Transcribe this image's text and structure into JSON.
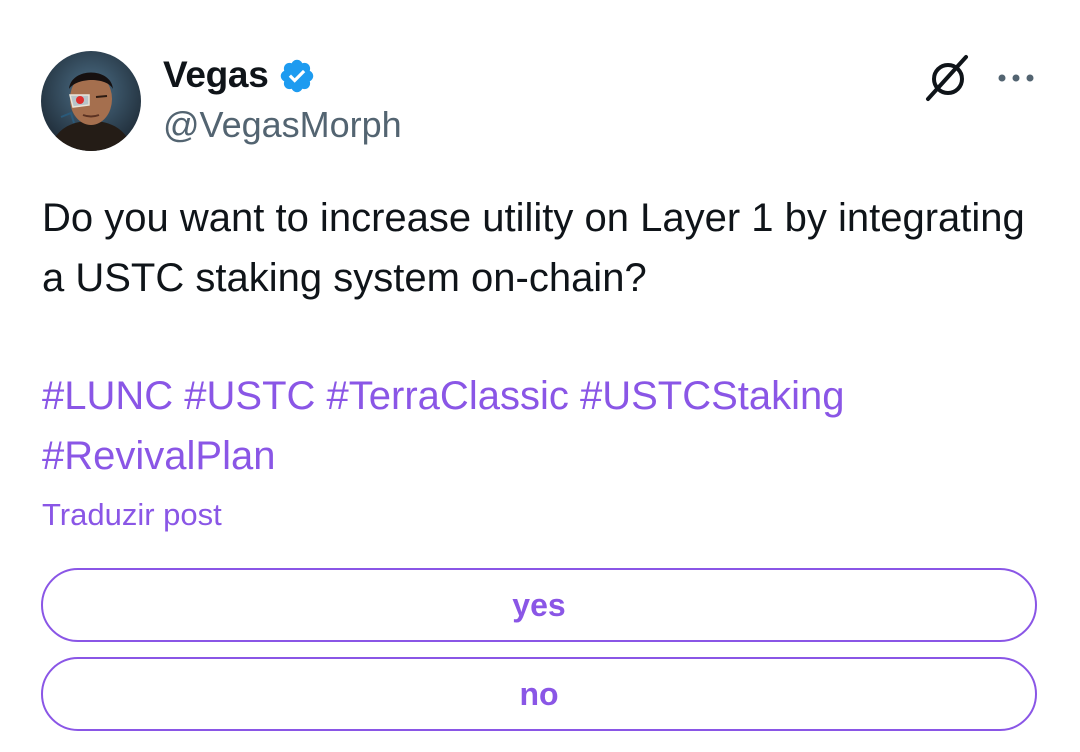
{
  "post": {
    "author": {
      "display_name": "Vegas",
      "handle": "@VegasMorph",
      "verified_icon": "verified-badge-icon"
    },
    "text": "Do you want to increase utility on Layer 1 by integrating a USTC staking system on-chain?",
    "hashtags": [
      "#LUNC",
      "#USTC",
      "#TerraClassic",
      "#USTCStaking",
      "#RevivalPlan"
    ],
    "translate_label": "Traduzir post",
    "poll": {
      "options": [
        {
          "label": "yes"
        },
        {
          "label": "no"
        }
      ]
    }
  },
  "header_icons": [
    "grok-icon",
    "more-options-icon"
  ],
  "colors": {
    "accent": "#8a56e6",
    "verified": "#1d9bf0",
    "text": "#0f1419",
    "secondary_text": "#536471"
  }
}
